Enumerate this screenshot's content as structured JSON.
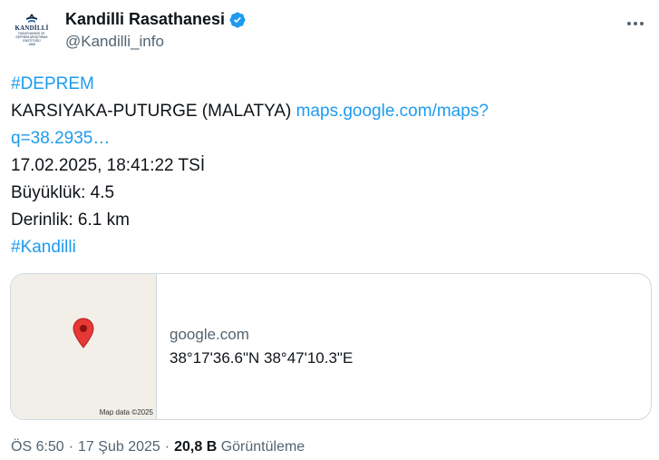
{
  "author": {
    "avatar_text_main": "KANDİLLİ",
    "avatar_text_sub": "RASATHANESİ VE DEPREM ARAŞTIRMA ENSTİTÜSÜ",
    "avatar_text_year": "1868",
    "display_name": "Kandilli Rasathanesi",
    "handle": "@Kandilli_info",
    "verified": true,
    "verified_color": "#1d9bf0"
  },
  "tweet": {
    "hashtag_1": "#DEPREM",
    "location": "KARSIYAKA-PUTURGE (MALATYA)",
    "link_part_1": "maps.google.com/maps?",
    "link_part_2": "q=38.2935…",
    "datetime": "17.02.2025, 18:41:22 TSİ",
    "magnitude": "Büyüklük: 4.5",
    "depth": "Derinlik: 6.1 km",
    "hashtag_2": "#Kandilli",
    "link_color": "#1d9bf0"
  },
  "card": {
    "map_attribution": "Map data ©2025",
    "domain": "google.com",
    "coordinates": "38°17'36.6\"N 38°47'10.3\"E",
    "pin_color": "#e53935"
  },
  "meta": {
    "time": "ÖS 6:50",
    "separator": "·",
    "date": "17 Şub 2025",
    "views_count": "20,8 B",
    "views_label": "Görüntüleme"
  }
}
